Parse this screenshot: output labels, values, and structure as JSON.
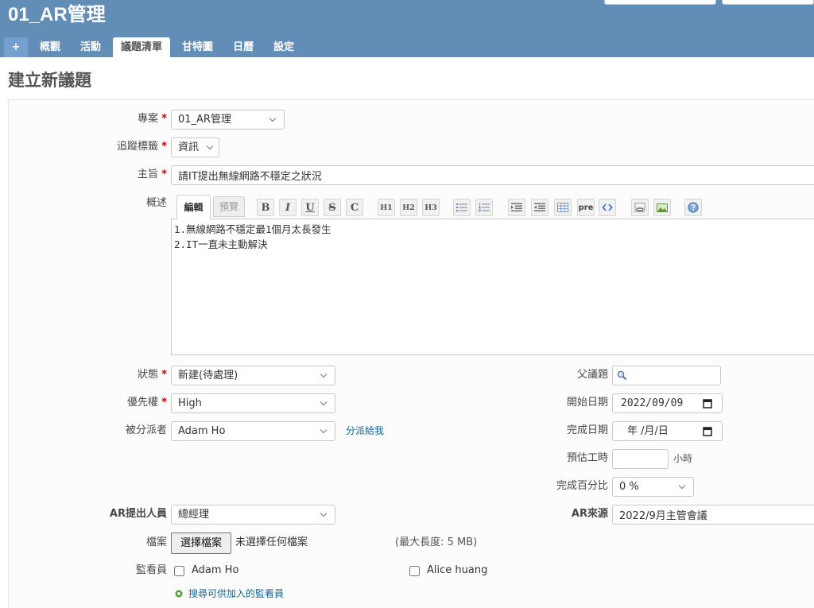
{
  "header": {
    "project_title": "01_AR管理"
  },
  "menu": {
    "tabs": [
      "+",
      "概觀",
      "活動",
      "議題清單",
      "甘特圖",
      "日曆",
      "設定"
    ],
    "selected": "議題清單"
  },
  "page": {
    "title": "建立新議題"
  },
  "required_mark": "*",
  "form": {
    "project": {
      "label": "專案",
      "value": "01_AR管理"
    },
    "tracker": {
      "label": "追蹤標籤",
      "value": "資訊"
    },
    "subject": {
      "label": "主旨",
      "value": "請IT提出無線網路不穩定之狀況"
    },
    "description": {
      "label": "概述",
      "tab_edit": "編輯",
      "tab_preview": "預覽",
      "toolbar": {
        "bold": "B",
        "italic": "I",
        "underline": "U",
        "strike": "S",
        "code": "C",
        "h1": "H1",
        "h2": "H2",
        "h3": "H3",
        "pre": "pre"
      },
      "toolbar_icons": [
        "unordered-list-icon",
        "ordered-list-icon",
        "blockquote-icon",
        "unblockquote-icon",
        "table-icon",
        "code-highlight-icon",
        "wiki-link-icon",
        "image-icon",
        "help-icon"
      ],
      "value": "1.無線網路不穩定最1個月太長發生\n2.IT一直未主動解決"
    },
    "status": {
      "label": "狀態",
      "value": "新建(待處理)"
    },
    "priority": {
      "label": "優先權",
      "value": "High"
    },
    "assignee": {
      "label": "被分派者",
      "value": "Adam Ho",
      "assign_to_me": "分派給我"
    },
    "parent_issue": {
      "label": "父議題"
    },
    "start_date": {
      "label": "開始日期",
      "value": "2022/09/09"
    },
    "due_date": {
      "label": "完成日期",
      "placeholder": "年 /月/日"
    },
    "estimated_time": {
      "label": "預估工時",
      "unit": "小時"
    },
    "done_ratio": {
      "label": "完成百分比",
      "value": "0 %"
    },
    "ar_requester": {
      "label": "AR提出人員",
      "value": "總經理"
    },
    "ar_source": {
      "label": "AR來源",
      "value": "2022/9月主管會議"
    },
    "files": {
      "label": "檔案",
      "button": "選擇檔案",
      "status": "未選擇任何檔案",
      "max_size": "(最大長度: 5 MB)"
    },
    "watchers": {
      "label": "監看員",
      "users": [
        {
          "name": "Adam Ho",
          "checked": false
        },
        {
          "name": "Alice huang",
          "checked": false
        }
      ],
      "search_link": "搜尋可供加入的監看員"
    }
  },
  "colors": {
    "header": "#628db6",
    "link": "#116699",
    "required": "#bb0000",
    "add_icon": "#4a9e3a"
  }
}
